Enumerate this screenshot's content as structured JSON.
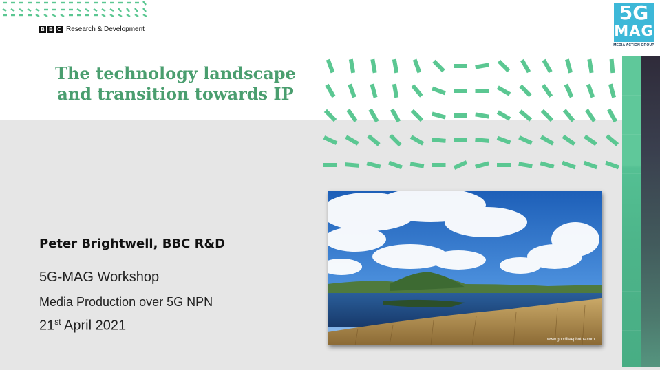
{
  "header": {
    "bbc_letters": [
      "B",
      "B",
      "C"
    ],
    "org_label": "Research & Development"
  },
  "title": {
    "line1": "The technology landscape",
    "line2": "and transition towards IP"
  },
  "logo": {
    "line1": "5G",
    "line2": "MAG",
    "tagline": "MEDIA ACTION GROUP"
  },
  "presenter": "Peter Brightwell, BBC R&D",
  "event": "5G-MAG Workshop",
  "subtitle": "Media Production over 5G NPN",
  "date": {
    "day": "21",
    "suffix": "st",
    "rest": " April 2021"
  },
  "photo": {
    "watermark": "www.goodfreephotos.com"
  },
  "colors": {
    "accent_green": "#4a9e6f",
    "dash_green": "#5bc792",
    "logo_blue": "#3db8d8",
    "dark_side": "#2f2b3a"
  }
}
